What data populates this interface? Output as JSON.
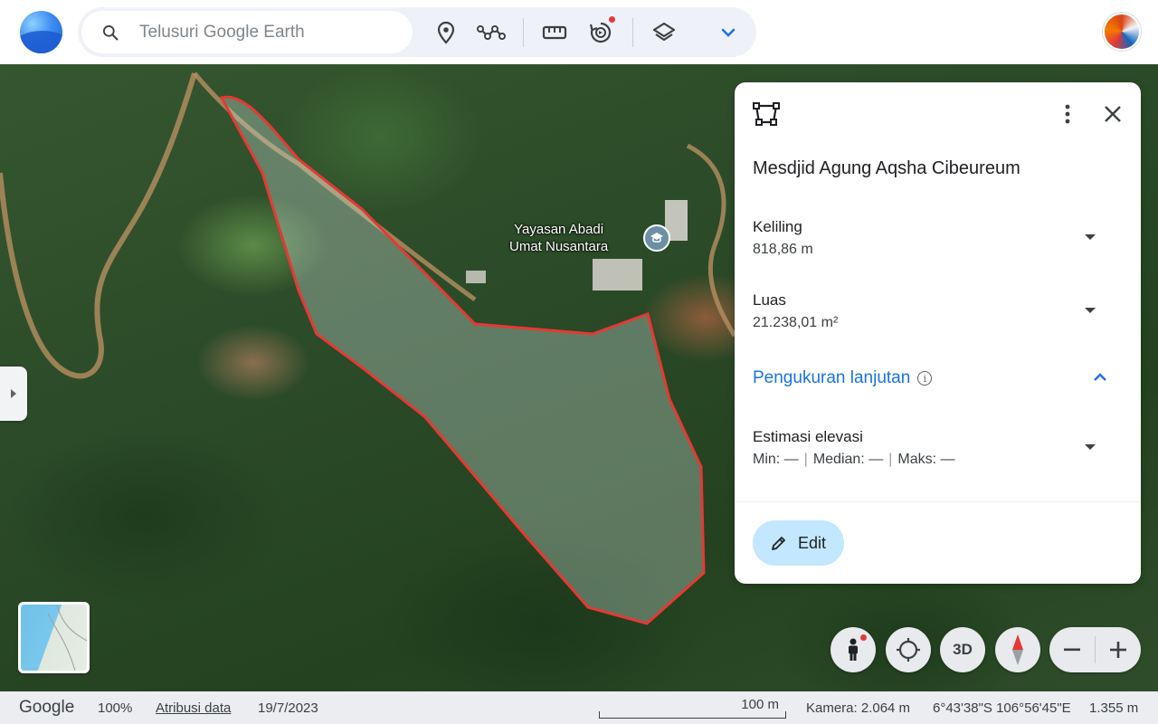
{
  "search": {
    "placeholder": "Telusuri Google Earth"
  },
  "toolbar": {
    "icons": [
      "place-pin-icon",
      "path-icon",
      "ruler-icon",
      "voyager-icon",
      "layers-icon",
      "chevron-down-icon"
    ]
  },
  "map": {
    "poi_label": "Yayasan Abadi\nUmat Nusantara",
    "polygon_stroke_color": "#e53935"
  },
  "panel": {
    "title": "Mesdjid Agung Aqsha Cibeureum",
    "perimeter": {
      "label": "Keliling",
      "value": "818,86 m"
    },
    "area": {
      "label": "Luas",
      "value": "21.238,01 m²"
    },
    "advanced": {
      "label": "Pengukuran lanjutan",
      "info": "i"
    },
    "elevation": {
      "label": "Estimasi elevasi",
      "min": "Min: —",
      "median": "Median: —",
      "max": "Maks: —",
      "separator": "|"
    },
    "edit_label": "Edit"
  },
  "controls": {
    "three_d_label": "3D"
  },
  "status": {
    "brand": "Google",
    "zoom": "100%",
    "attribution": "Atribusi data",
    "date": "19/7/2023",
    "scale": "100 m",
    "camera": "Kamera: 2.064 m",
    "coords": "6°43'38\"S 106°56'45\"E",
    "elevation": "1.355 m"
  },
  "colors": {
    "accent": "#1a73e8",
    "edit_bg": "#c2e7ff",
    "polygon": "#e53935"
  }
}
